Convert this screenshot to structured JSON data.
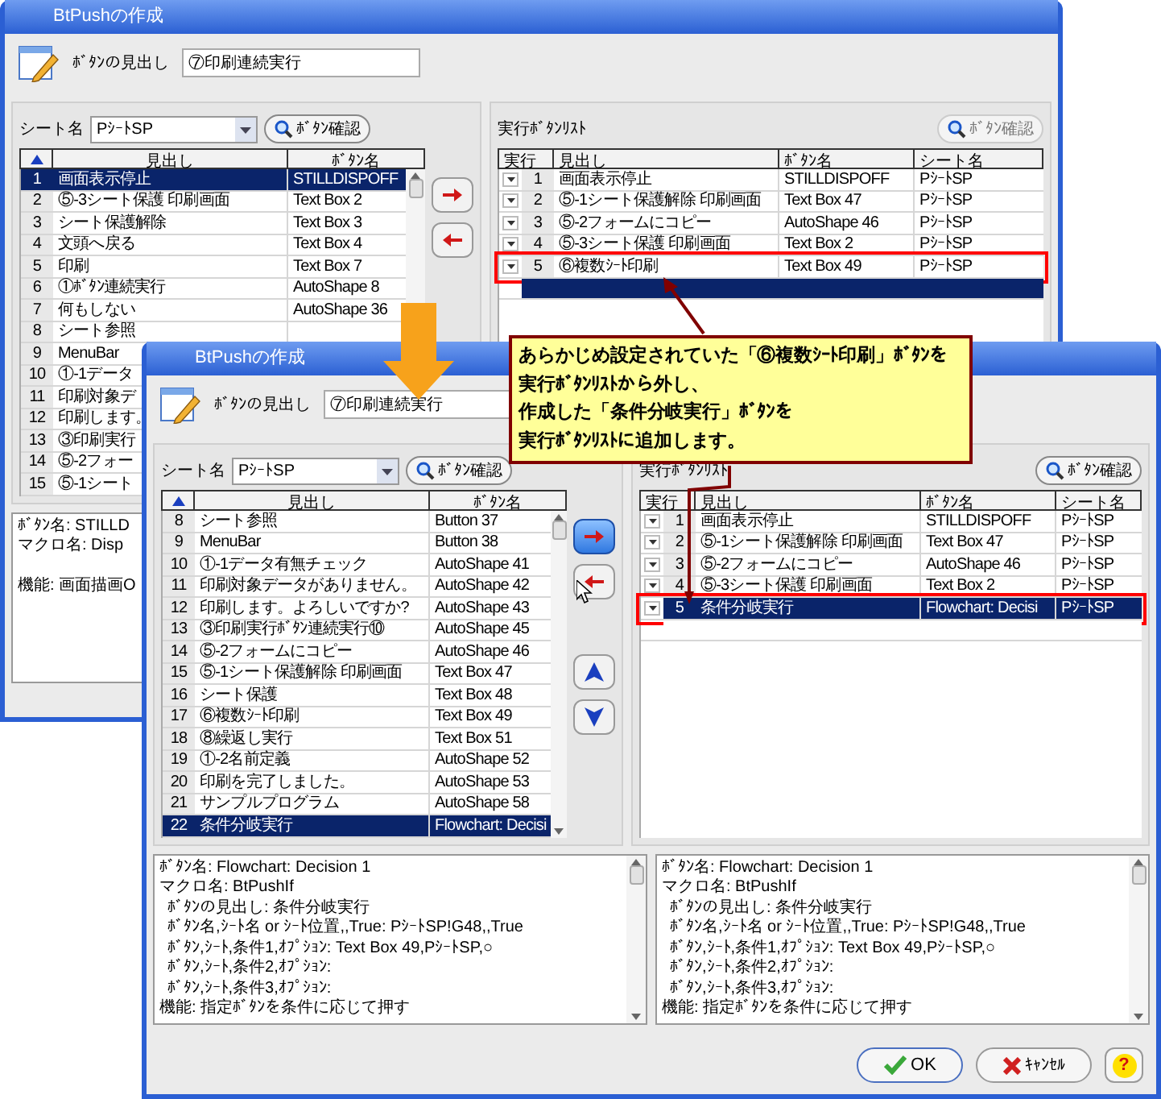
{
  "back_window": {
    "title": "BtPushの作成",
    "heading_label": "ﾎﾞﾀﾝの見出し",
    "heading_value": "⑦印刷連続実行",
    "sheet_label": "シート名",
    "sheet_value": "PｼｰﾄSP",
    "left_check_button": {
      "label": "ﾎﾞﾀﾝ確認",
      "disabled": false
    },
    "add_button_hovered": false,
    "left_table": {
      "columns": [
        "見出し",
        "ﾎﾞﾀﾝ名"
      ],
      "rows": [
        {
          "no": "1",
          "caption": "画面表示停止",
          "button": "STILLDISPOFF",
          "selected": true
        },
        {
          "no": "2",
          "caption": "⑤-3シート保護 印刷画面",
          "button": "Text Box 2",
          "selected": false
        },
        {
          "no": "3",
          "caption": "シート保護解除",
          "button": "Text Box 3",
          "selected": false
        },
        {
          "no": "4",
          "caption": "文頭へ戻る",
          "button": "Text Box 4",
          "selected": false
        },
        {
          "no": "5",
          "caption": "印刷",
          "button": "Text Box 7",
          "selected": false
        },
        {
          "no": "6",
          "caption": "①ﾎﾞﾀﾝ連続実行",
          "button": "AutoShape 8",
          "selected": false
        },
        {
          "no": "7",
          "caption": "何もしない",
          "button": "AutoShape 36",
          "selected": false
        },
        {
          "no": "8",
          "caption": "シート参照",
          "selected": false
        },
        {
          "no": "9",
          "caption": "MenuBar",
          "selected": false
        },
        {
          "no": "10",
          "caption": "①-1データ",
          "selected": false
        },
        {
          "no": "11",
          "caption": "印刷対象デ",
          "selected": false
        },
        {
          "no": "12",
          "caption": "印刷します。",
          "selected": false
        },
        {
          "no": "13",
          "caption": "③印刷実行",
          "selected": false
        },
        {
          "no": "14",
          "caption": "⑤-2フォー",
          "selected": false
        },
        {
          "no": "15",
          "caption": "⑤-1シート",
          "selected": false
        }
      ]
    },
    "run_list": {
      "title": "実行ﾎﾞﾀﾝﾘｽﾄ",
      "check_button": {
        "label": "ﾎﾞﾀﾝ確認",
        "disabled": true
      },
      "columns": [
        "実行",
        "見出し",
        "ﾎﾞﾀﾝ名",
        "シート名"
      ],
      "new_row_selected": true,
      "rows": [
        {
          "no": "1",
          "caption": "画面表示停止",
          "button": "STILLDISPOFF",
          "sheet": "PｼｰﾄSP",
          "selected": false,
          "outlined": false
        },
        {
          "no": "2",
          "caption": "⑤-1シート保護解除 印刷画面",
          "button": "Text Box 47",
          "sheet": "PｼｰﾄSP",
          "selected": false,
          "outlined": false
        },
        {
          "no": "3",
          "caption": "⑤-2フォームにコピー",
          "button": "AutoShape 46",
          "sheet": "PｼｰﾄSP",
          "selected": false,
          "outlined": false
        },
        {
          "no": "4",
          "caption": "⑤-3シート保護 印刷画面",
          "button": "Text Box 2",
          "sheet": "PｼｰﾄSP",
          "selected": false,
          "outlined": false
        },
        {
          "no": "5",
          "caption": "⑥複数ｼｰﾄ印刷",
          "button": "Text Box 49",
          "sheet": "PｼｰﾄSP",
          "selected": false,
          "outlined": true
        }
      ]
    },
    "details": [
      {
        "lines": [
          {
            "text": "ﾎﾞﾀﾝ名: STILLD",
            "indent": false
          },
          {
            "text": "マクロ名: Disp",
            "indent": false
          }
        ],
        "footer": "機能: 画面描画O"
      }
    ]
  },
  "front_window": {
    "title": "BtPushの作成",
    "heading_label": "ﾎﾞﾀﾝの見出し",
    "heading_value": "⑦印刷連続実行",
    "sheet_label": "シート名",
    "sheet_value": "PｼｰﾄSP",
    "left_check_button": {
      "label": "ﾎﾞﾀﾝ確認",
      "disabled": false
    },
    "add_button_hovered": true,
    "order_buttons": [
      {
        "kind": "up"
      },
      {
        "kind": "down"
      }
    ],
    "left_table": {
      "columns": [
        "見出し",
        "ﾎﾞﾀﾝ名"
      ],
      "rows": [
        {
          "no": "8",
          "caption": "シート参照",
          "button": "Button 37",
          "selected": false
        },
        {
          "no": "9",
          "caption": "MenuBar",
          "button": "Button 38",
          "selected": false
        },
        {
          "no": "10",
          "caption": "①-1データ有無チェック",
          "button": "AutoShape 41",
          "selected": false
        },
        {
          "no": "11",
          "caption": "印刷対象データがありません。",
          "button": "AutoShape 42",
          "selected": false
        },
        {
          "no": "12",
          "caption": "印刷します。よろしいですか?",
          "button": "AutoShape 43",
          "selected": false
        },
        {
          "no": "13",
          "caption": "③印刷実行ﾎﾞﾀﾝ連続実行⑩",
          "button": "AutoShape 45",
          "selected": false
        },
        {
          "no": "14",
          "caption": "⑤-2フォームにコピー",
          "button": "AutoShape 46",
          "selected": false
        },
        {
          "no": "15",
          "caption": "⑤-1シート保護解除 印刷画面",
          "button": "Text Box 47",
          "selected": false
        },
        {
          "no": "16",
          "caption": "シート保護",
          "button": "Text Box 48",
          "selected": false
        },
        {
          "no": "17",
          "caption": "⑥複数ｼｰﾄ印刷",
          "button": "Text Box 49",
          "selected": false
        },
        {
          "no": "18",
          "caption": "⑧繰返し実行",
          "button": "Text Box 51",
          "selected": false
        },
        {
          "no": "19",
          "caption": "①-2名前定義",
          "button": "AutoShape 52",
          "selected": false
        },
        {
          "no": "20",
          "caption": "印刷を完了しました。",
          "button": "AutoShape 53",
          "selected": false
        },
        {
          "no": "21",
          "caption": "サンプルプログラム",
          "button": "AutoShape 58",
          "selected": false
        },
        {
          "no": "22",
          "caption": "条件分岐実行",
          "button": "Flowchart: Decisi",
          "selected": true
        }
      ]
    },
    "run_list": {
      "title": "実行ﾎﾞﾀﾝﾘｽﾄ",
      "check_button": {
        "label": "ﾎﾞﾀﾝ確認",
        "disabled": false
      },
      "columns": [
        "実行",
        "見出し",
        "ﾎﾞﾀﾝ名",
        "シート名"
      ],
      "new_row_selected": false,
      "rows": [
        {
          "no": "1",
          "caption": "画面表示停止",
          "button": "STILLDISPOFF",
          "sheet": "PｼｰﾄSP",
          "selected": false,
          "outlined": false
        },
        {
          "no": "2",
          "caption": "⑤-1シート保護解除 印刷画面",
          "button": "Text Box 47",
          "sheet": "PｼｰﾄSP",
          "selected": false,
          "outlined": false
        },
        {
          "no": "3",
          "caption": "⑤-2フォームにコピー",
          "button": "AutoShape 46",
          "sheet": "PｼｰﾄSP",
          "selected": false,
          "outlined": false
        },
        {
          "no": "4",
          "caption": "⑤-3シート保護 印刷画面",
          "button": "Text Box 2",
          "sheet": "PｼｰﾄSP",
          "selected": false,
          "outlined": false
        },
        {
          "no": "5",
          "caption": "条件分岐実行",
          "button": "Flowchart: Decisi",
          "sheet": "PｼｰﾄSP",
          "selected": true,
          "outlined": true
        }
      ]
    },
    "details": [
      {
        "lines": [
          {
            "text": "ﾎﾞﾀﾝ名: Flowchart: Decision 1",
            "indent": false
          },
          {
            "text": "マクロ名: BtPushIf",
            "indent": false
          },
          {
            "text": "ﾎﾞﾀﾝの見出し: 条件分岐実行",
            "indent": true
          },
          {
            "text": "ﾎﾞﾀﾝ名,ｼｰﾄ名 or ｼｰﾄ位置,,True: PｼｰﾄSP!G48,,True",
            "indent": true
          },
          {
            "text": "ﾎﾞﾀﾝ,ｼｰﾄ,条件1,ｵﾌﾟｼｮﾝ: Text Box 49,PｼｰﾄSP,○",
            "indent": true
          },
          {
            "text": "ﾎﾞﾀﾝ,ｼｰﾄ,条件2,ｵﾌﾟｼｮﾝ:",
            "indent": true
          },
          {
            "text": "ﾎﾞﾀﾝ,ｼｰﾄ,条件3,ｵﾌﾟｼｮﾝ:",
            "indent": true
          }
        ],
        "footer": "機能: 指定ﾎﾞﾀﾝを条件に応じて押す"
      },
      {
        "lines": [
          {
            "text": "ﾎﾞﾀﾝ名: Flowchart: Decision 1",
            "indent": false
          },
          {
            "text": "マクロ名: BtPushIf",
            "indent": false
          },
          {
            "text": "ﾎﾞﾀﾝの見出し: 条件分岐実行",
            "indent": true
          },
          {
            "text": "ﾎﾞﾀﾝ名,ｼｰﾄ名 or ｼｰﾄ位置,,True: PｼｰﾄSP!G48,,True",
            "indent": true
          },
          {
            "text": "ﾎﾞﾀﾝ,ｼｰﾄ,条件1,ｵﾌﾟｼｮﾝ: Text Box 49,PｼｰﾄSP,○",
            "indent": true
          },
          {
            "text": "ﾎﾞﾀﾝ,ｼｰﾄ,条件2,ｵﾌﾟｼｮﾝ:",
            "indent": true
          },
          {
            "text": "ﾎﾞﾀﾝ,ｼｰﾄ,条件3,ｵﾌﾟｼｮﾝ:",
            "indent": true
          }
        ],
        "footer": "機能: 指定ﾎﾞﾀﾝを条件に応じて押す"
      }
    ],
    "buttons": [
      {
        "kind": "ok",
        "label": "OK"
      },
      {
        "kind": "cancel",
        "label": "ｷｬﾝｾﾙ"
      },
      {
        "kind": "help",
        "label": "?"
      }
    ]
  },
  "callout": {
    "lines": [
      "あらかじめ設定されていた「⑥複数ｼｰﾄ印刷」ﾎﾞﾀﾝを",
      "実行ﾎﾞﾀﾝﾘｽﾄから外し、",
      "作成した「条件分岐実行」ﾎﾞﾀﾝを",
      "実行ﾎﾞﾀﾝﾘｽﾄに追加します。"
    ]
  }
}
